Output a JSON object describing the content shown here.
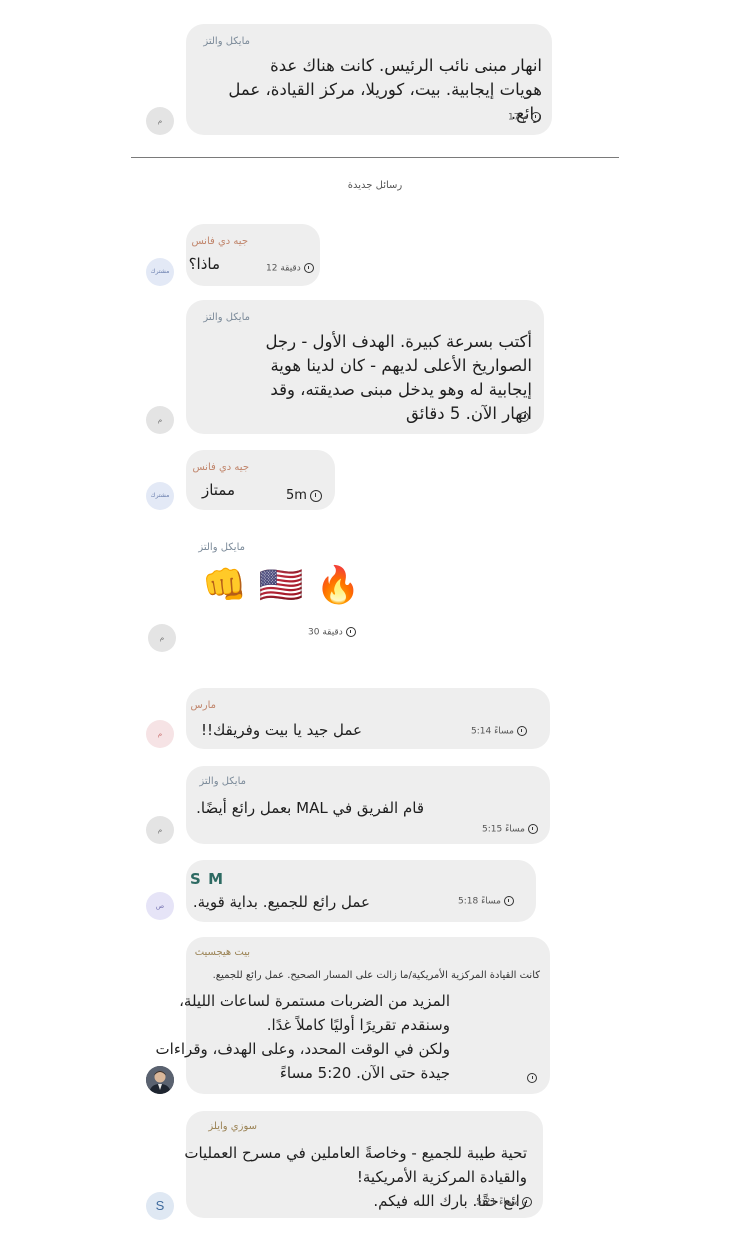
{
  "messages": [
    {
      "sender": "مايكل والتز",
      "lines": [
        "انهار مبنى نائب الرئيس. كانت هناك عدة",
        "هويات إيجابية. بيت، كوريلا، مركز القيادة، عمل",
        "رائع."
      ],
      "time": "17 م",
      "avatar": "م"
    },
    {
      "sender": "جيه دي فانس",
      "lines": [
        "ماذا؟"
      ],
      "time": "12 دقيقة",
      "avatar": "مشترك"
    },
    {
      "sender": "مايكل والتز",
      "lines": [
        "أكتب بسرعة كبيرة. الهدف الأول - رجل",
        "الصواريخ الأعلى لديهم - كان لدينا هوية",
        "إيجابية له وهو يدخل مبنى صديقته، وقد",
        "انهار الآن. 5 دقائق"
      ],
      "time": "",
      "avatar": "م"
    },
    {
      "sender": "جيه دي فانس",
      "lines": [
        "ممتاز"
      ],
      "time": "5m",
      "avatar": "مشترك"
    },
    {
      "sender": "مايكل والتز",
      "emojis": [
        "👊",
        "🇺🇸",
        "🔥"
      ],
      "time": "30 دقيقة",
      "avatar": "م"
    },
    {
      "sender": "مارس",
      "lines": [
        "عمل جيد يا بيت وفريقك!!"
      ],
      "time": "5:14 مساءً",
      "avatar": "م"
    },
    {
      "sender": "مايكل والتز",
      "lines": [
        "قام الفريق في MAL بعمل رائع أيضًا."
      ],
      "time": "5:15 مساءً",
      "avatar": "م"
    },
    {
      "sender": "S M",
      "lines": [
        "عمل رائع للجميع. بداية قوية."
      ],
      "time": "5:18 مساءً",
      "avatar": "ص"
    },
    {
      "sender": "بيت هيجسيث",
      "quote": "كانت القيادة المركزية الأمريكية/ما زالت على المسار الصحيح. عمل رائع للجميع.",
      "lines": [
        "المزيد من الضربات مستمرة لساعات الليلة،",
        "وسنقدم تقريرًا أوليًا كاملاً غدًا.",
        "ولكن في الوقت المحدد، وعلى الهدف، وقراءات",
        "جيدة حتى الآن. 5:20 مساءً"
      ],
      "time": ""
    },
    {
      "sender": "سوزي وايلز",
      "lines": [
        "تحية طيبة للجميع - وخاصةً العاملين في مسرح العمليات",
        "والقيادة المركزية الأمريكية!",
        "رائع حقًا. بارك الله فيكم."
      ],
      "time": "5:21 مساءً",
      "avatar": "S"
    }
  ],
  "divider_label": "رسائل جديدة"
}
